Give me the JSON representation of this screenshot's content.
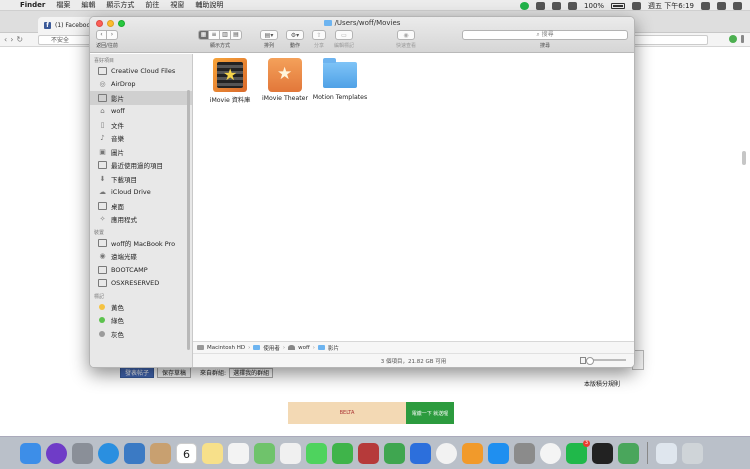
{
  "menubar": {
    "app": "Finder",
    "items": [
      "檔案",
      "編輯",
      "顯示方式",
      "前往",
      "視窗",
      "輔助說明"
    ],
    "battery": "100%",
    "clock": "週五 下午6:19"
  },
  "browser": {
    "tab_title": "(1) Faceboo",
    "url_text": "不安全",
    "post_button": "發表帖子",
    "draft_button": "保存草稿",
    "group_label": "來自群組:",
    "group_select": "選擇我的群組",
    "board_rule": "本版積分規則",
    "ad_text": "BELTA",
    "ad_cta": "電繳一下 就送喔"
  },
  "finder": {
    "title": "/Users/woff/Movies",
    "toolbar": {
      "back_forward": "返回/往前",
      "view": "顯示方式",
      "arrange": "排列",
      "action": "動作",
      "share": "分享",
      "edit_tags": "編輯標記",
      "quick_look": "快速查看",
      "search_label": "搜尋",
      "search_placeholder": "搜尋"
    },
    "sidebar": {
      "favorites_header": "喜好項目",
      "favorites": [
        {
          "label": "Creative Cloud Files",
          "icon": "document-box-icon"
        },
        {
          "label": "AirDrop",
          "icon": "airdrop-icon"
        },
        {
          "label": "影片",
          "icon": "film-icon"
        },
        {
          "label": "woff",
          "icon": "home-icon"
        },
        {
          "label": "文件",
          "icon": "documents-icon"
        },
        {
          "label": "音樂",
          "icon": "music-icon"
        },
        {
          "label": "圖片",
          "icon": "camera-icon"
        },
        {
          "label": "最近使用過的項目",
          "icon": "recents-icon"
        },
        {
          "label": "下載項目",
          "icon": "download-icon"
        },
        {
          "label": "iCloud Drive",
          "icon": "cloud-icon"
        },
        {
          "label": "桌面",
          "icon": "desktop-icon"
        },
        {
          "label": "應用程式",
          "icon": "applications-icon"
        }
      ],
      "devices_header": "裝置",
      "devices": [
        {
          "label": "woff的 MacBook Pro",
          "icon": "laptop-icon"
        },
        {
          "label": "遠端光碟",
          "icon": "disc-icon"
        },
        {
          "label": "BOOTCAMP",
          "icon": "disk-icon"
        },
        {
          "label": "OSXRESERVED",
          "icon": "disk-icon"
        }
      ],
      "tags_header": "標記",
      "tags": [
        {
          "label": "黃色",
          "color": "#f5c342"
        },
        {
          "label": "綠色",
          "color": "#5cc24d"
        },
        {
          "label": "灰色",
          "color": "#9b9b9b"
        }
      ]
    },
    "files": [
      {
        "name": "iMovie 資料庫",
        "icon": "imovie-library-icon"
      },
      {
        "name": "iMovie Theater",
        "icon": "imovie-theater-icon"
      },
      {
        "name": "Motion Templates",
        "icon": "folder-icon"
      }
    ],
    "path": [
      "Macintosh HD",
      "使用者",
      "woff",
      "影片"
    ],
    "status": "3 個項目，21.82 GB 可用"
  },
  "dock": {
    "apps": [
      {
        "name": "finder-icon",
        "color": "#3d8ee8"
      },
      {
        "name": "siri-icon",
        "color": "#6f3cc7"
      },
      {
        "name": "launchpad-icon",
        "color": "#8a8f98"
      },
      {
        "name": "safari-icon",
        "color": "#2a8fe0"
      },
      {
        "name": "mail-stamp-icon",
        "color": "#3b7ac4"
      },
      {
        "name": "contacts-icon",
        "color": "#c8a070"
      },
      {
        "name": "calendar-icon",
        "color": "#ffffff"
      },
      {
        "name": "notes-icon",
        "color": "#f7e08a"
      },
      {
        "name": "reminders-icon",
        "color": "#f3f3f3"
      },
      {
        "name": "maps-icon",
        "color": "#6fc36b"
      },
      {
        "name": "photos-icon",
        "color": "#f0f0f0"
      },
      {
        "name": "messages-icon",
        "color": "#4ed35e"
      },
      {
        "name": "facetime-icon",
        "color": "#3fb44a"
      },
      {
        "name": "photo-booth-icon",
        "color": "#b63a3a"
      },
      {
        "name": "numbers-icon",
        "color": "#3fa650"
      },
      {
        "name": "keynote-icon",
        "color": "#2c6fdc"
      },
      {
        "name": "itunes-icon",
        "color": "#f2f2f2"
      },
      {
        "name": "ibooks-icon",
        "color": "#f19a2b"
      },
      {
        "name": "app-store-icon",
        "color": "#1f8ff0"
      },
      {
        "name": "system-preferences-icon",
        "color": "#8b8b8b"
      },
      {
        "name": "chrome-icon",
        "color": "#f4f4f4"
      },
      {
        "name": "line-icon",
        "color": "#20b84a"
      },
      {
        "name": "terminal-icon",
        "color": "#222222"
      },
      {
        "name": "android-studio-icon",
        "color": "#4aa65c"
      },
      {
        "name": "folder-stack-icon",
        "color": "#dfe6ee"
      },
      {
        "name": "trash-icon",
        "color": "#cfd4d8"
      }
    ],
    "calendar_day": "6",
    "line_badge": "3"
  }
}
